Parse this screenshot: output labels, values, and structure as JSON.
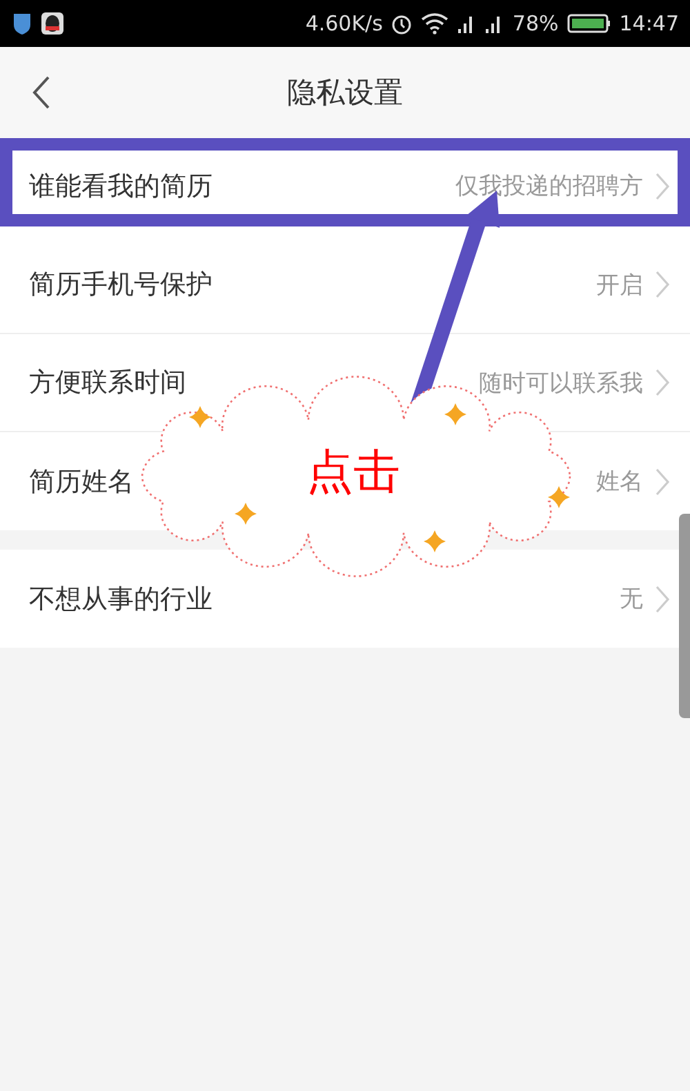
{
  "status_bar": {
    "net_speed": "4.60K/s",
    "battery": "78%",
    "time": "14:47"
  },
  "header": {
    "title": "隐私设置"
  },
  "groups": [
    {
      "rows": [
        {
          "label": "谁能看我的简历",
          "value": "仅我投递的招聘方",
          "highlighted": true
        },
        {
          "label": "简历手机号保护",
          "value": "开启",
          "highlighted": false
        },
        {
          "label": "方便联系时间",
          "value": "随时可以联系我",
          "highlighted": false
        },
        {
          "label": "简历姓名",
          "value": "姓名",
          "highlighted": false
        }
      ]
    },
    {
      "rows": [
        {
          "label": "不想从事的行业",
          "value": "无",
          "highlighted": false
        }
      ]
    }
  ],
  "annotation": {
    "callout": "点击"
  }
}
